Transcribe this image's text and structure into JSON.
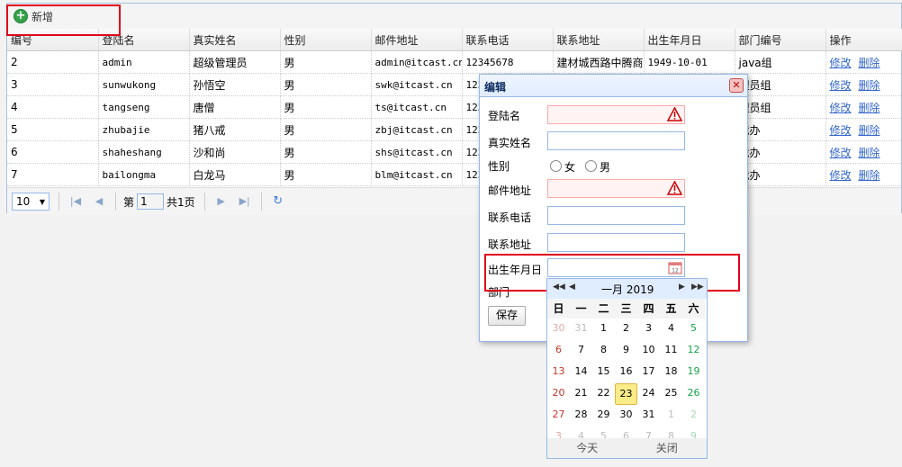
{
  "toolbar": {
    "add_label": "新增"
  },
  "grid": {
    "columns": [
      "编号",
      "登陆名",
      "真实姓名",
      "性别",
      "邮件地址",
      "联系电话",
      "联系地址",
      "出生年月日",
      "部门编号",
      "操作"
    ],
    "rows": [
      {
        "id": "2",
        "login": "admin",
        "name": "超级管理员",
        "gender": "男",
        "email": "admin@itcast.cn",
        "phone": "12345678",
        "address": "建材城西路中腾商",
        "birth": "1949-10-01",
        "dept": "java组"
      },
      {
        "id": "3",
        "login": "sunwukong",
        "name": "孙悟空",
        "gender": "男",
        "email": "swk@itcast.cn",
        "phone": "123",
        "address": "",
        "birth": "",
        "dept": "理员组"
      },
      {
        "id": "4",
        "login": "tangseng",
        "name": "唐僧",
        "gender": "男",
        "email": "ts@itcast.cn",
        "phone": "123",
        "address": "",
        "birth": "",
        "dept": "理员组"
      },
      {
        "id": "5",
        "login": "zhubajie",
        "name": "猪八戒",
        "gender": "男",
        "email": "zbj@itcast.cn",
        "phone": "123",
        "address": "",
        "birth": "",
        "dept": "裁办"
      },
      {
        "id": "6",
        "login": "shaheshang",
        "name": "沙和尚",
        "gender": "男",
        "email": "shs@itcast.cn",
        "phone": "123",
        "address": "",
        "birth": "",
        "dept": "裁办"
      },
      {
        "id": "7",
        "login": "bailongma",
        "name": "白龙马",
        "gender": "男",
        "email": "blm@itcast.cn",
        "phone": "123",
        "address": "",
        "birth": "",
        "dept": "裁办"
      }
    ],
    "edit_label": "修改",
    "delete_label": "删除"
  },
  "pager": {
    "page_size": "10",
    "page_prefix": "第",
    "page_value": "1",
    "page_suffix": "共1页"
  },
  "dialog": {
    "title": "编辑",
    "close_icon": "close-icon",
    "fields": {
      "login": "登陆名",
      "realname": "真实姓名",
      "gender": "性别",
      "female": "女",
      "male": "男",
      "email": "邮件地址",
      "phone": "联系电话",
      "address": "联系地址",
      "birth": "出生年月日",
      "dept": "部门"
    },
    "save_label": "保存"
  },
  "calendar": {
    "title": "一月 2019",
    "weekdays": [
      "日",
      "一",
      "二",
      "三",
      "四",
      "五",
      "六"
    ],
    "weeks": [
      [
        "30",
        "31",
        "1",
        "2",
        "3",
        "4",
        "5"
      ],
      [
        "6",
        "7",
        "8",
        "9",
        "10",
        "11",
        "12"
      ],
      [
        "13",
        "14",
        "15",
        "16",
        "17",
        "18",
        "19"
      ],
      [
        "20",
        "21",
        "22",
        "23",
        "24",
        "25",
        "26"
      ],
      [
        "27",
        "28",
        "29",
        "30",
        "31",
        "1",
        "2"
      ],
      [
        "3",
        "4",
        "5",
        "6",
        "7",
        "8",
        "9"
      ]
    ],
    "today": "23",
    "today_label": "今天",
    "close_label": "关闭"
  }
}
